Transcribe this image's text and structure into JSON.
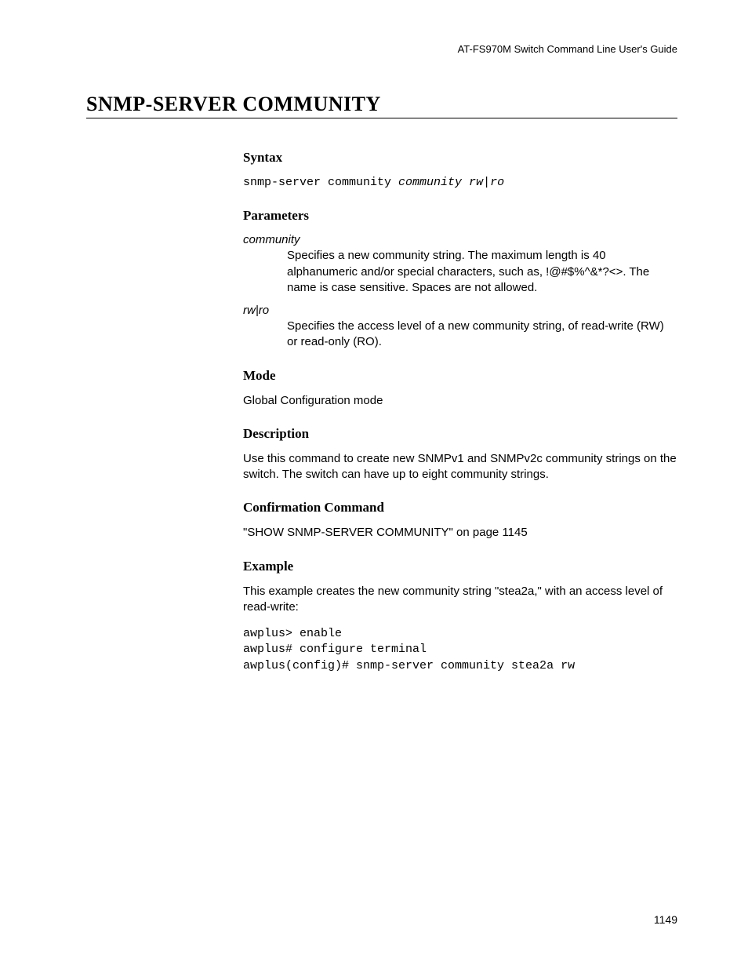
{
  "header": "AT-FS970M Switch Command Line User's Guide",
  "title": "SNMP-SERVER COMMUNITY",
  "syntax": {
    "heading": "Syntax",
    "cmd_prefix": "snmp-server community ",
    "cmd_args": "community rw|ro"
  },
  "parameters": {
    "heading": "Parameters",
    "items": [
      {
        "name": "community",
        "desc": "Specifies a new community string. The maximum length is 40 alphanumeric and/or special characters, such as, !@#$%^&*?<>. The name is case sensitive. Spaces are not allowed."
      },
      {
        "name": "rw|ro",
        "desc": "Specifies the access level of a new community string, of read-write (RW) or read-only (RO)."
      }
    ]
  },
  "mode": {
    "heading": "Mode",
    "text": "Global Configuration mode"
  },
  "description": {
    "heading": "Description",
    "text": "Use this command to create new SNMPv1 and SNMPv2c community strings on the switch. The switch can have up to eight community strings."
  },
  "confirmation": {
    "heading": "Confirmation Command",
    "text": "\"SHOW SNMP-SERVER COMMUNITY\" on page 1145"
  },
  "example": {
    "heading": "Example",
    "intro": "This example creates the new community string \"stea2a,\" with an access level of read-write:",
    "code": "awplus> enable\nawplus# configure terminal\nawplus(config)# snmp-server community stea2a rw"
  },
  "page_number": "1149"
}
